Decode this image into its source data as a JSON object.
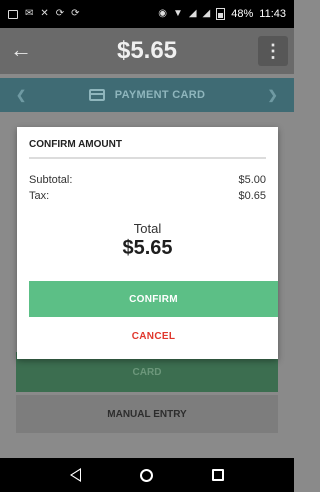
{
  "status_bar": {
    "battery": "48%",
    "time": "11:43"
  },
  "header": {
    "title": "$5.65",
    "back_icon": "arrow-left-icon",
    "more_icon": "more-vertical-icon"
  },
  "payment_method_bar": {
    "label": "PAYMENT CARD",
    "icon": "credit-card-icon"
  },
  "underlay_buttons": {
    "card_label": "CARD",
    "manual_entry_label": "MANUAL ENTRY"
  },
  "dialog": {
    "title": "CONFIRM AMOUNT",
    "subtotal_label": "Subtotal:",
    "subtotal_value": "$5.00",
    "tax_label": "Tax:",
    "tax_value": "$0.65",
    "total_label": "Total",
    "total_value": "$5.65",
    "confirm_label": "CONFIRM",
    "cancel_label": "CANCEL"
  },
  "colors": {
    "confirm_green": "#5cbf86",
    "cancel_red": "#e0362c",
    "accent_teal": "#3f6b74"
  }
}
